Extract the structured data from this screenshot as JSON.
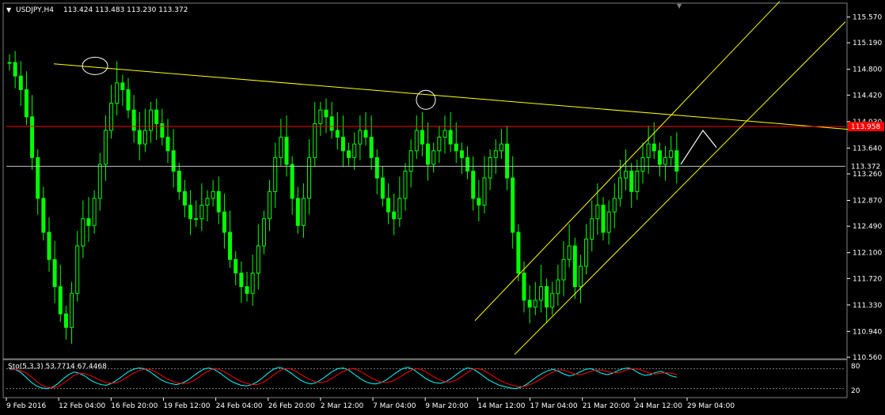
{
  "header": {
    "symbol": "USDJPY,H4",
    "ohlc": "113.424 113.483 113.230 113.372"
  },
  "indicator": {
    "label": "Sto(5,3,3) 53.7714 67.4468",
    "levels": [
      "80",
      "20"
    ]
  },
  "colors": {
    "background": "#000000",
    "candle": "#00ff00",
    "trend": "#ffff00",
    "resistance": "#ff0000",
    "price_line": "#c0c0c0",
    "sto_main": "#00ffff",
    "sto_signal": "#ff0000",
    "axis": "#ffffff"
  },
  "chart_data": {
    "type": "candlestick",
    "symbol": "USDJPY",
    "timeframe": "H4",
    "ylim": [
      110.56,
      115.75
    ],
    "yticks": [
      "115.570",
      "115.190",
      "114.800",
      "114.420",
      "114.030",
      "113.640",
      "113.260",
      "112.870",
      "112.490",
      "112.100",
      "111.720",
      "111.330",
      "110.940",
      "110.560"
    ],
    "xticks": [
      "9 Feb 2016",
      "12 Feb 04:00",
      "16 Feb 20:00",
      "19 Feb 12:00",
      "24 Feb 04:00",
      "26 Feb 20:00",
      "2 Mar 12:00",
      "7 Mar 04:00",
      "9 Mar 20:00",
      "14 Mar 12:00",
      "17 Mar 04:00",
      "21 Mar 20:00",
      "24 Mar 12:00",
      "29 Mar 04:00"
    ],
    "current_price": "113.372",
    "resistance_level": "113.958",
    "closes": [
      114.9,
      114.7,
      114.5,
      114.1,
      113.5,
      112.9,
      112.4,
      112.0,
      111.6,
      111.2,
      111.0,
      111.5,
      112.2,
      112.6,
      112.5,
      112.9,
      113.4,
      113.9,
      114.3,
      114.6,
      114.5,
      114.2,
      113.9,
      113.7,
      113.9,
      114.2,
      114.0,
      113.8,
      113.6,
      113.3,
      113.0,
      112.8,
      112.6,
      112.6,
      112.8,
      112.9,
      113.0,
      112.7,
      112.4,
      112.0,
      111.8,
      111.6,
      111.5,
      111.8,
      112.2,
      112.6,
      113.0,
      113.5,
      113.8,
      113.4,
      112.9,
      112.5,
      112.9,
      113.5,
      114.0,
      114.2,
      114.1,
      113.9,
      113.8,
      113.6,
      113.5,
      113.7,
      113.9,
      113.8,
      113.5,
      113.2,
      112.9,
      112.7,
      112.6,
      112.9,
      113.3,
      113.6,
      113.9,
      113.7,
      113.4,
      113.6,
      113.8,
      113.9,
      113.7,
      113.6,
      113.5,
      113.3,
      112.9,
      112.8,
      113.2,
      113.5,
      113.6,
      113.7,
      113.2,
      112.4,
      111.8,
      111.4,
      111.3,
      111.4,
      111.6,
      111.3,
      111.5,
      111.7,
      112.0,
      112.2,
      111.6,
      111.9,
      112.3,
      112.6,
      112.8,
      112.4,
      112.7,
      112.9,
      113.2,
      113.3,
      113.0,
      113.3,
      113.5,
      113.7,
      113.6,
      113.4,
      113.5,
      113.6,
      113.3
    ],
    "resistance_trendline": [
      [
        0.0,
        114.88
      ],
      [
        1.0,
        113.9
      ]
    ],
    "channel_upper": [
      [
        0.0,
        111.1
      ],
      [
        1.0,
        115.8
      ]
    ],
    "channel_lower": [
      [
        0.0,
        110.6
      ],
      [
        1.0,
        115.5
      ]
    ],
    "highlights": [
      {
        "price": 114.85
      },
      {
        "price": 114.35
      }
    ],
    "stochastic": {
      "main": [
        80,
        78,
        70,
        55,
        40,
        28,
        22,
        20,
        24,
        35,
        50,
        62,
        70,
        66,
        58,
        46,
        38,
        32,
        30,
        36,
        46,
        58,
        70,
        78,
        82,
        80,
        72,
        60,
        48,
        40,
        35,
        32,
        36,
        44,
        56,
        68,
        78,
        82,
        78,
        68,
        56,
        44,
        36,
        30,
        28,
        32,
        40,
        52,
        66,
        78,
        84,
        80,
        70,
        58,
        46,
        38,
        34,
        38,
        48,
        60,
        72,
        80,
        82,
        76,
        64,
        52,
        42,
        36,
        34,
        38,
        46,
        58,
        70,
        80,
        84,
        78,
        66,
        54,
        44,
        38,
        36,
        40,
        50,
        62,
        74,
        82,
        80,
        70,
        58,
        46,
        38,
        30,
        26,
        22,
        20,
        24,
        32,
        44,
        56,
        66,
        74,
        78,
        72,
        64,
        58,
        62,
        70,
        78,
        80,
        74,
        66,
        62,
        66,
        74,
        80,
        82,
        76,
        66,
        60,
        62,
        68,
        72,
        66,
        58,
        54
      ],
      "signal": [
        76,
        78,
        75,
        68,
        56,
        42,
        30,
        24,
        22,
        26,
        36,
        48,
        60,
        66,
        65,
        60,
        52,
        44,
        38,
        36,
        38,
        46,
        56,
        66,
        74,
        78,
        78,
        72,
        62,
        52,
        44,
        38,
        35,
        36,
        42,
        52,
        64,
        74,
        80,
        78,
        70,
        60,
        50,
        42,
        36,
        32,
        32,
        38,
        48,
        60,
        72,
        80,
        80,
        74,
        64,
        54,
        46,
        40,
        38,
        42,
        52,
        62,
        72,
        78,
        80,
        74,
        64,
        54,
        46,
        40,
        38,
        42,
        50,
        60,
        70,
        78,
        80,
        74,
        64,
        54,
        46,
        40,
        40,
        46,
        56,
        68,
        78,
        80,
        76,
        66,
        56,
        46,
        38,
        32,
        28,
        26,
        28,
        34,
        42,
        52,
        62,
        70,
        76,
        76,
        70,
        64,
        62,
        66,
        72,
        76,
        76,
        72,
        68,
        68,
        72,
        78,
        80,
        78,
        72,
        66,
        64,
        66,
        68,
        66,
        62
      ],
      "levels": [
        80,
        20
      ]
    }
  }
}
